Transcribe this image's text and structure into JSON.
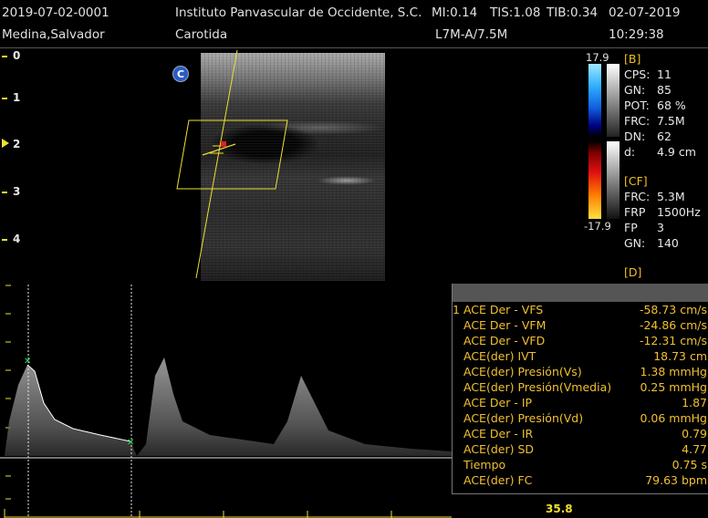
{
  "header": {
    "patient_id": "2019-07-02-0001",
    "patient_name": "Medina,Salvador",
    "institution": "Instituto Panvascular de Occidente, S.C.",
    "mi": "MI:0.14",
    "tis": "TIS:1.08",
    "tib": "TIB:0.34",
    "date": "02-07-2019",
    "study": "Carotida",
    "probe": "L7M-A/7.5M",
    "time": "10:29:38"
  },
  "depth_scale": [
    "0",
    "1",
    "2",
    "3",
    "4"
  ],
  "logo_letter": "C",
  "color_scale": {
    "top": "17.9",
    "bottom": "-17.9"
  },
  "b_params": {
    "section": "[B]",
    "rows": [
      {
        "k": "CPS:",
        "v": "11"
      },
      {
        "k": "GN:",
        "v": "85"
      },
      {
        "k": "POT:",
        "v": "68 %"
      },
      {
        "k": "FRC:",
        "v": "7.5M"
      },
      {
        "k": "DN:",
        "v": "62"
      },
      {
        "k": "d:",
        "v": "4.9 cm"
      }
    ]
  },
  "cf_params": {
    "section": "[CF]",
    "rows": [
      {
        "k": "FRC:",
        "v": "5.3M"
      },
      {
        "k": "FRP",
        "v": "1500Hz"
      },
      {
        "k": "FP",
        "v": "3"
      },
      {
        "k": "GN:",
        "v": "140"
      }
    ]
  },
  "d_params": {
    "section": "[D]"
  },
  "measurements": [
    {
      "prefix": "1",
      "label": "ACE Der - VFS",
      "value": "-58.73 cm/s"
    },
    {
      "prefix": "",
      "label": "ACE Der - VFM",
      "value": "-24.86 cm/s"
    },
    {
      "prefix": "",
      "label": "ACE Der - VFD",
      "value": "-12.31 cm/s"
    },
    {
      "prefix": "",
      "label": "ACE(der) IVT",
      "value": "18.73 cm"
    },
    {
      "prefix": "",
      "label": "ACE(der) Presión(Vs)",
      "value": "1.38 mmHg"
    },
    {
      "prefix": "",
      "label": "ACE(der) Presión(Vmedia)",
      "value": "0.25 mmHg"
    },
    {
      "prefix": "",
      "label": "ACE Der - IP",
      "value": "1.87"
    },
    {
      "prefix": "",
      "label": "ACE(der) Presión(Vd)",
      "value": "0.06 mmHg"
    },
    {
      "prefix": "",
      "label": "ACE Der - IR",
      "value": "0.79"
    },
    {
      "prefix": "",
      "label": "ACE(der) SD",
      "value": "4.77"
    },
    {
      "prefix": "",
      "label": "Tiempo",
      "value": "0.75 s"
    },
    {
      "prefix": "",
      "label": "ACE(der) FC",
      "value": "79.63 bpm"
    }
  ],
  "bottom_scale_value": "35.8",
  "colors": {
    "accent": "#f0c030",
    "yellow": "#f0e030",
    "background": "#000000"
  }
}
